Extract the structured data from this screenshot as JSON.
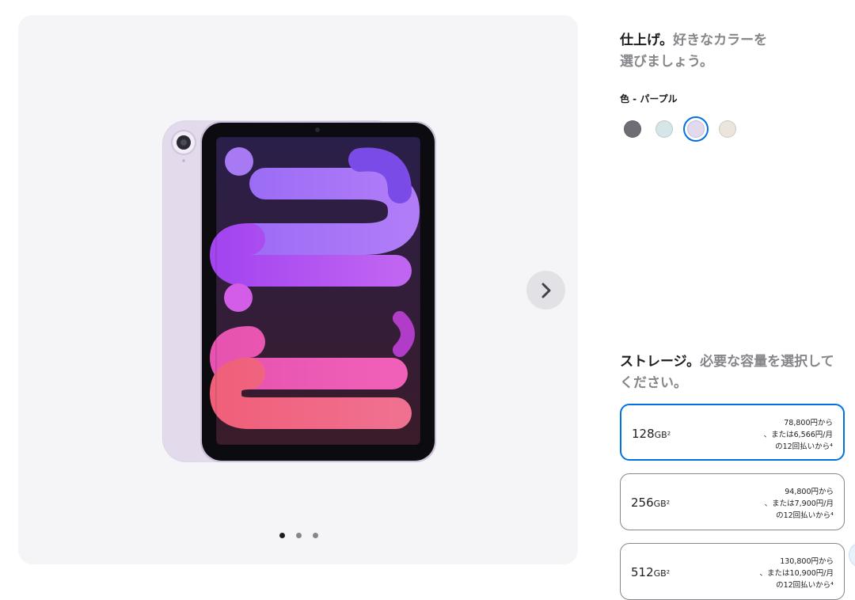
{
  "gallery": {
    "image_alt": "iPad mini パープル",
    "pagination_count": 3,
    "active_index": 0
  },
  "finish": {
    "title_bold": "仕上げ。",
    "title_muted_line1": "好きなカラーを",
    "title_muted_line2": "選びましょう。",
    "color_label": "色 - パープル",
    "swatches": [
      {
        "name": "スペースグレイ",
        "color": "#6f6d73"
      },
      {
        "name": "ブルー",
        "color": "#d6e5e8"
      },
      {
        "name": "パープル",
        "color": "#e3d9ef"
      },
      {
        "name": "スターライト",
        "color": "#ebe5db"
      }
    ],
    "selected_index": 2
  },
  "storage": {
    "title_bold": "ストレージ。",
    "title_muted_line1": "必要な容量を選択して",
    "title_muted_line2": "ください。",
    "options": [
      {
        "size": "128",
        "unit": "GB²",
        "price": "78,800円から",
        "monthly": "、または6,566円/月",
        "installments": "の12回払いから⁴",
        "selected": true
      },
      {
        "size": "256",
        "unit": "GB²",
        "price": "94,800円から",
        "monthly": "、または7,900円/月",
        "installments": "の12回払いから⁴",
        "selected": false
      },
      {
        "size": "512",
        "unit": "GB²",
        "price": "130,800円から",
        "monthly": "、または10,900円/月",
        "installments": "の12回払いから⁴",
        "selected": false
      }
    ]
  },
  "colors": {
    "accent": "#0071e3",
    "gallery_bg": "#f5f5f7",
    "muted_text": "#86868b"
  }
}
